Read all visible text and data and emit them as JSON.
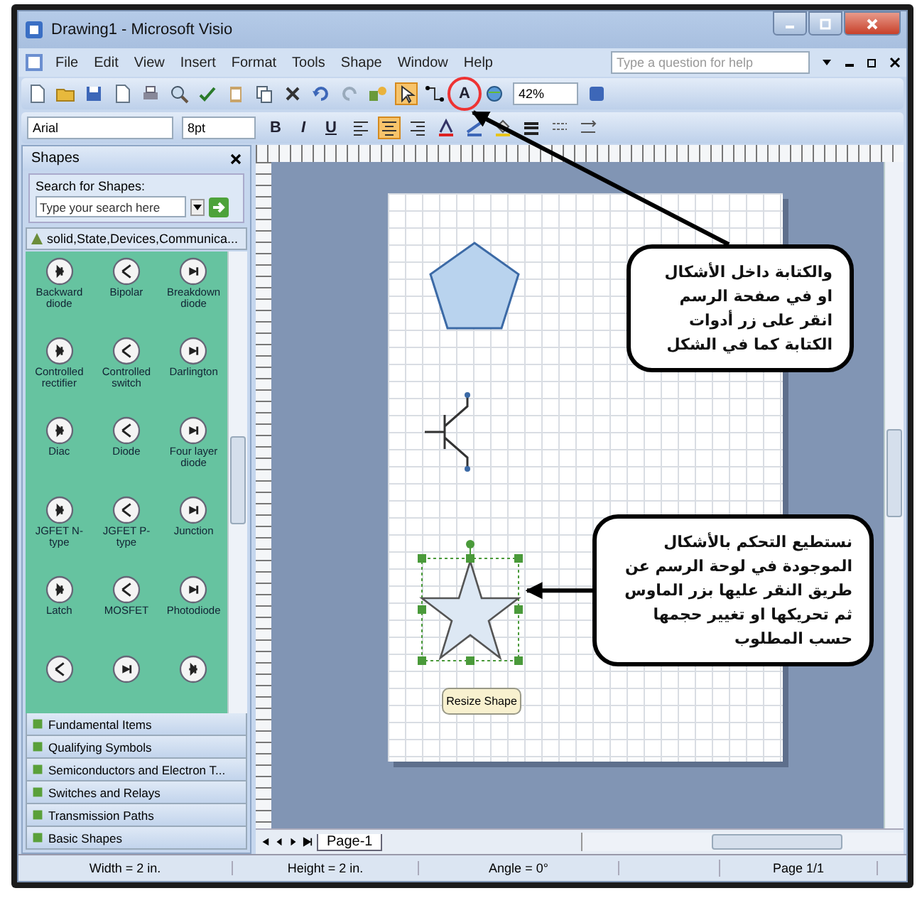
{
  "window": {
    "title": "Drawing1 - Microsoft Visio"
  },
  "menu": [
    {
      "label": "File"
    },
    {
      "label": "Edit"
    },
    {
      "label": "View"
    },
    {
      "label": "Insert"
    },
    {
      "label": "Format"
    },
    {
      "label": "Tools"
    },
    {
      "label": "Shape"
    },
    {
      "label": "Window"
    },
    {
      "label": "Help"
    }
  ],
  "help_box": {
    "placeholder": "Type a question for help"
  },
  "standard_toolbar": {
    "pointer_tool": {
      "selected": true
    },
    "text_tool": {
      "label": "A",
      "selected": false
    },
    "zoom": "42%"
  },
  "format_toolbar": {
    "font": "Arial",
    "size": "8pt",
    "styles": [
      {
        "label": "B"
      },
      {
        "label": "I"
      },
      {
        "label": "U"
      }
    ],
    "align": [
      {
        "kind": "left",
        "selected": false
      },
      {
        "kind": "center",
        "selected": true
      },
      {
        "kind": "right",
        "selected": false
      }
    ]
  },
  "shapes_panel": {
    "title": "Shapes",
    "search_label": "Search for Shapes:",
    "search_placeholder": "Type your search here",
    "stencil_title": "solid,State,Devices,Communica...",
    "masters": [
      {
        "label": "Backward diode"
      },
      {
        "label": "Bipolar"
      },
      {
        "label": "Breakdown diode"
      },
      {
        "label": "Controlled rectifier"
      },
      {
        "label": "Controlled switch"
      },
      {
        "label": "Darlington"
      },
      {
        "label": "Diac"
      },
      {
        "label": "Diode"
      },
      {
        "label": "Four layer diode"
      },
      {
        "label": "JGFET N-type"
      },
      {
        "label": "JGFET P-type"
      },
      {
        "label": "Junction"
      },
      {
        "label": "Latch"
      },
      {
        "label": "MOSFET"
      },
      {
        "label": "Photodiode"
      }
    ],
    "stencils": [
      {
        "label": "Fundamental Items"
      },
      {
        "label": "Qualifying Symbols"
      },
      {
        "label": "Semiconductors and Electron T..."
      },
      {
        "label": "Switches and Relays"
      },
      {
        "label": "Transmission Paths"
      },
      {
        "label": "Basic Shapes"
      }
    ]
  },
  "drawing": {
    "tooltip": "Resize Shape",
    "page_tab": "Page-1",
    "callouts": [
      {
        "text": "والكتابة داخل الأشكال او في صفحة الرسم انقر على زر أدوات الكتابة كما في الشكل"
      },
      {
        "text": "نستطيع التحكم بالأشكال الموجودة في لوحة الرسم عن طريق النقر عليها بزر الماوس ثم تحريكها او تغيير حجمها حسب المطلوب"
      }
    ]
  },
  "status_bar": [
    "Width = 2 in.",
    "Height = 2 in.",
    "Angle = 0°",
    "Page 1/1"
  ]
}
